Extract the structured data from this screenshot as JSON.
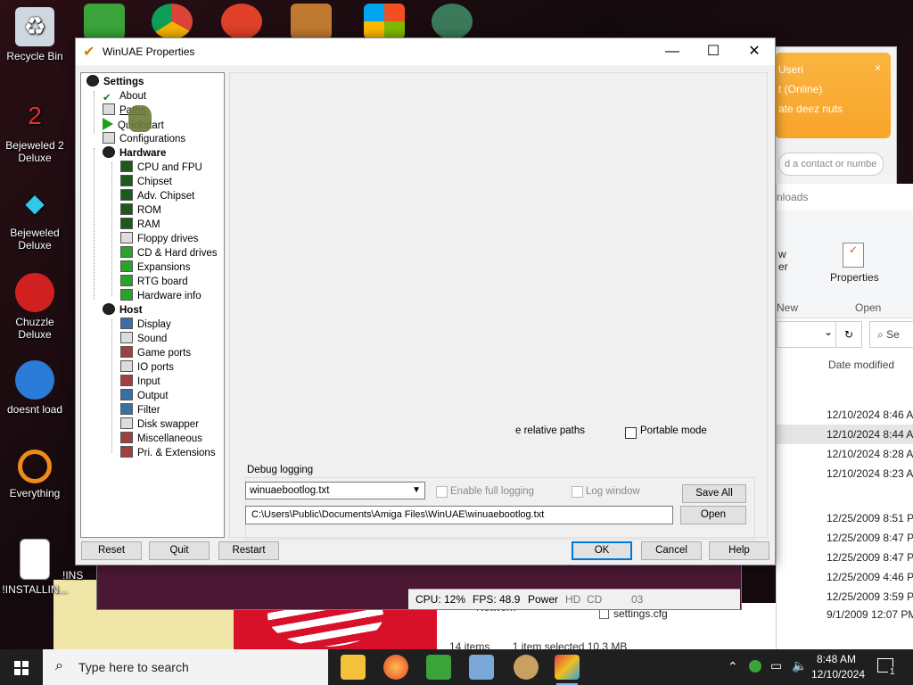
{
  "desktop": {
    "icons": [
      {
        "label": "Recycle Bin",
        "icon": "recycle-bin-icon"
      },
      {
        "label": "Bejeweled 2 Deluxe",
        "icon": "bejeweled2-icon"
      },
      {
        "label": "Bejeweled Deluxe",
        "icon": "bejeweled-icon"
      },
      {
        "label": "Chuzzle Deluxe",
        "icon": "chuzzle-icon"
      },
      {
        "label": "doesnt load",
        "icon": "thunderbird-icon"
      },
      {
        "label": "Everything",
        "icon": "everything-icon"
      },
      {
        "label": "!INSTALLIN...",
        "icon": "document-icon"
      },
      {
        "label": "!INS",
        "icon": "document-icon"
      }
    ]
  },
  "background_windows": {
    "chat": {
      "line1": "Useri",
      "line2": "t (Online)",
      "line3": "ate deez nuts",
      "search_placeholder": "d a contact or numbe"
    },
    "explorer": {
      "title": "nloads",
      "ribbon_new": "New",
      "ribbon_open": "Open",
      "ribbon_properties": "Properties",
      "ribbon_partial1": "w",
      "ribbon_partial2": "er",
      "search_label": "Se",
      "column_header": "Date modified",
      "rows": [
        "12/10/2024 8:46 AM",
        "12/10/2024 8:44 AM",
        "12/10/2024 8:28 AM",
        "12/10/2024 8:23 AM",
        "12/25/2009 8:51 PM",
        "12/25/2009 8:47 PM",
        "12/25/2009 8:47 PM",
        "12/25/2009 4:46 PM",
        "12/25/2009 3:59 PM",
        "9/1/2009 12:07 PM"
      ],
      "file_name": "settings.cfg",
      "network_label": "Network",
      "status_items": "14 items",
      "status_selected": "1 item selected  10.3 MB"
    }
  },
  "winuae_status": {
    "cpu": "CPU: 12%",
    "fps": "FPS: 48.9",
    "power": "Power",
    "hd": "HD",
    "cd": "CD",
    "track": "03"
  },
  "dialog": {
    "title": "WinUAE Properties",
    "tree": {
      "settings": "Settings",
      "about": "About",
      "paths": "Paths",
      "quickstart": "Quickstart",
      "configurations": "Configurations",
      "hardware": "Hardware",
      "hardware_items": [
        "CPU and FPU",
        "Chipset",
        "Adv. Chipset",
        "ROM",
        "RAM",
        "Floppy drives",
        "CD & Hard drives",
        "Expansions",
        "RTG board",
        "Hardware info"
      ],
      "host": "Host",
      "host_items": [
        "Display",
        "Sound",
        "Game ports",
        "IO ports",
        "Input",
        "Output",
        "Filter",
        "Disk swapper",
        "Miscellaneous",
        "Pri. & Extensions"
      ]
    },
    "paths": {
      "relative_paths": "e relative paths",
      "portable_mode": "Portable mode"
    },
    "debug": {
      "group_label": "Debug logging",
      "log_file": "winuaebootlog.txt",
      "enable_full_logging": "Enable full logging",
      "log_window": "Log window",
      "save_all": "Save All",
      "path": "C:\\Users\\Public\\Documents\\Amiga Files\\WinUAE\\winuaebootlog.txt",
      "open": "Open"
    },
    "buttons": {
      "reset": "Reset",
      "quit": "Quit",
      "restart": "Restart",
      "ok": "OK",
      "cancel": "Cancel",
      "help": "Help"
    }
  },
  "taskbar": {
    "search_placeholder": "Type here to search",
    "time": "8:48 AM",
    "date": "12/10/2024",
    "notification_count": "1"
  }
}
